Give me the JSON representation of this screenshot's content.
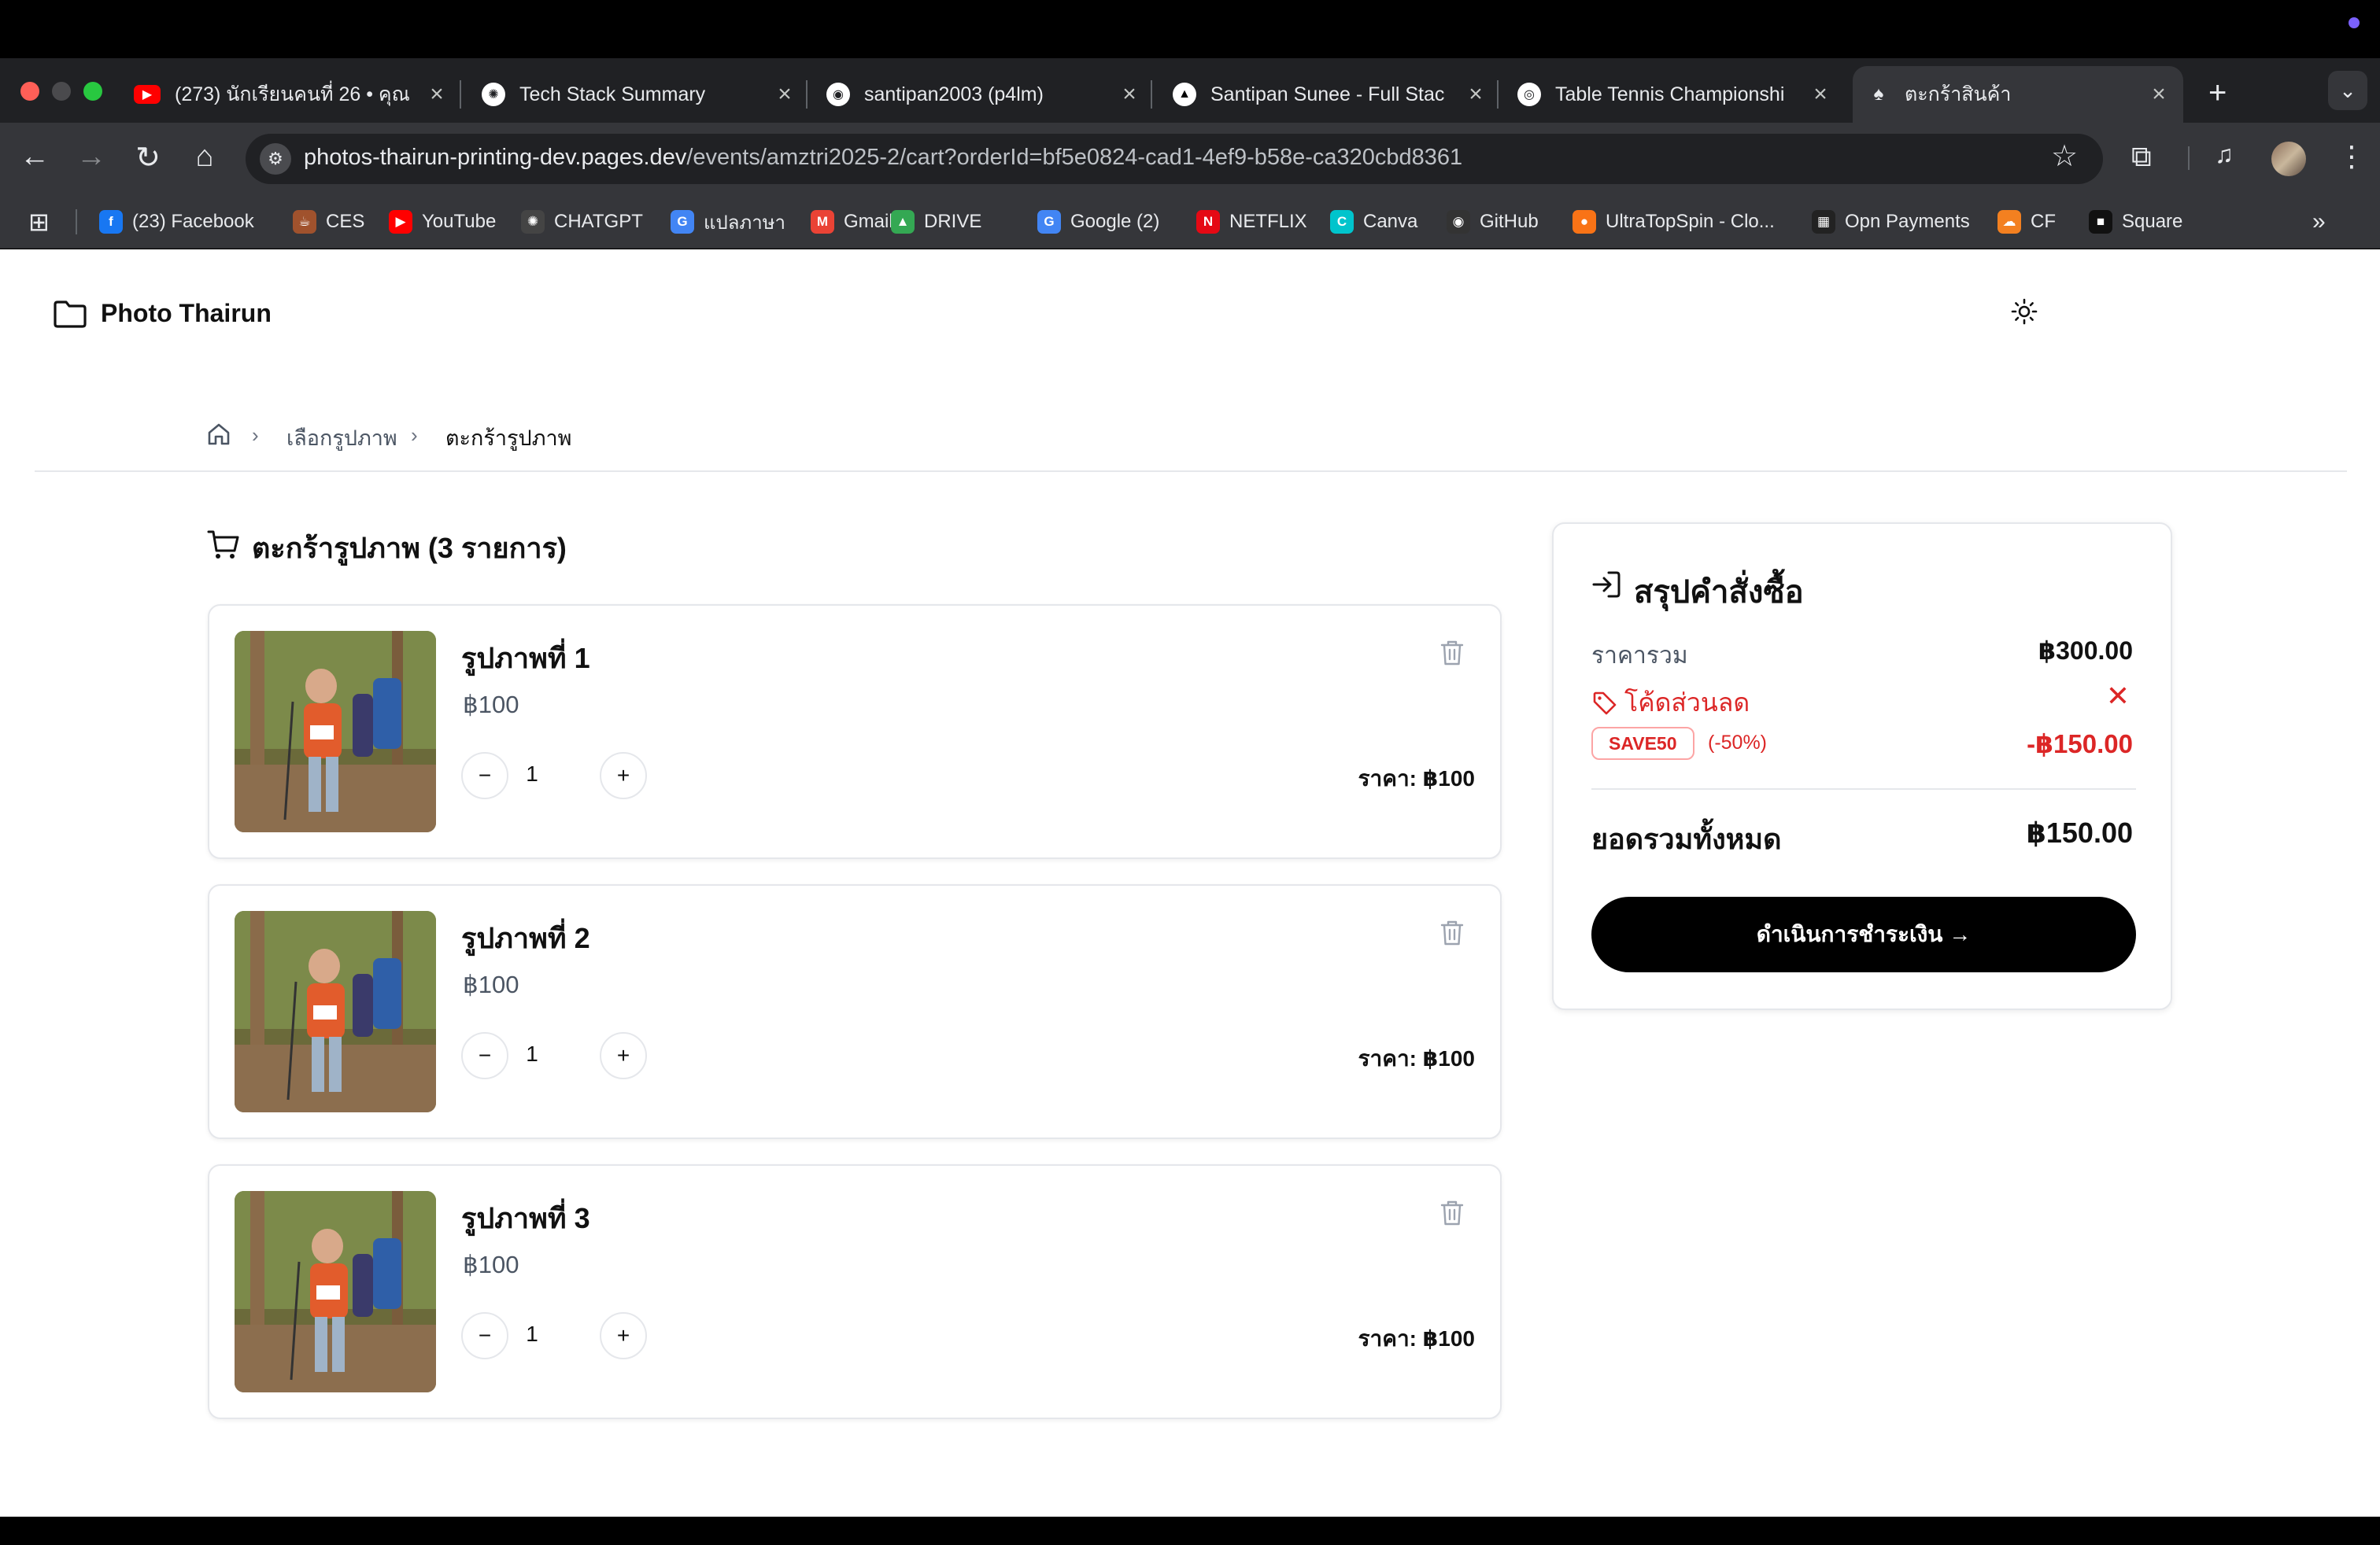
{
  "browser": {
    "tabs": [
      {
        "title": "(273) นักเรียนคนที่ 26 • คุณ",
        "icon": "youtube-icon",
        "color": "#ff0000"
      },
      {
        "title": "Tech Stack Summary",
        "icon": "openai-icon",
        "color": "#ffffff"
      },
      {
        "title": "santipan2003 (p4lm)",
        "icon": "github-icon",
        "color": "#ffffff"
      },
      {
        "title": "Santipan Sunee - Full Stac",
        "icon": "triangle-icon",
        "color": "#000000"
      },
      {
        "title": "Table Tennis Championshi",
        "icon": "ping-icon",
        "color": "#ffffff"
      },
      {
        "title": "ตะกร้าสินค้า",
        "icon": "astro-icon",
        "color": "#35363a"
      }
    ],
    "new_tab": "+",
    "url_host": "photos-thairun-printing-dev.pages.dev",
    "url_path": "/events/amztri2025-2/cart?orderId=bf5e0824-cad1-4ef9-b58e-ca320cbd8361",
    "bookmarks": [
      {
        "label": "(23) Facebook",
        "color": "#1877f2",
        "glyph": "f"
      },
      {
        "label": "CES",
        "color": "#a0522d",
        "glyph": "☕"
      },
      {
        "label": "YouTube",
        "color": "#ff0000",
        "glyph": "▶"
      },
      {
        "label": "CHATGPT",
        "color": "#444",
        "glyph": "✺"
      },
      {
        "label": "แปลภาษา",
        "color": "#4285f4",
        "glyph": "G"
      },
      {
        "label": "Gmail",
        "color": "#ea4335",
        "glyph": "M"
      },
      {
        "label": "DRIVE",
        "color": "#34a853",
        "glyph": "▲"
      },
      {
        "label": "Google (2)",
        "color": "#4285f4",
        "glyph": "G"
      },
      {
        "label": "NETFLIX",
        "color": "#e50914",
        "glyph": "N"
      },
      {
        "label": "Canva",
        "color": "#00c4cc",
        "glyph": "C"
      },
      {
        "label": "GitHub",
        "color": "#333",
        "glyph": "◉"
      },
      {
        "label": "UltraTopSpin - Clo...",
        "color": "#f97316",
        "glyph": "●"
      },
      {
        "label": "Opn Payments",
        "color": "#222",
        "glyph": "▦"
      },
      {
        "label": "CF",
        "color": "#f38020",
        "glyph": "☁"
      },
      {
        "label": "Square",
        "color": "#111",
        "glyph": "■"
      }
    ],
    "more_bookmarks": "»"
  },
  "site": {
    "brand": "Photo Thairun"
  },
  "breadcrumb": {
    "separator": "›",
    "link": "เลือกรูปภาพ",
    "current": "ตะกร้ารูปภาพ"
  },
  "cart": {
    "title": "ตะกร้ารูปภาพ (3 รายการ)",
    "items": [
      {
        "name": "รูปภาพที่ 1",
        "price": "฿100",
        "qty": "1",
        "line_total": "ราคา: ฿100"
      },
      {
        "name": "รูปภาพที่ 2",
        "price": "฿100",
        "qty": "1",
        "line_total": "ราคา: ฿100"
      },
      {
        "name": "รูปภาพที่ 3",
        "price": "฿100",
        "qty": "1",
        "line_total": "ราคา: ฿100"
      }
    ],
    "minus": "−",
    "plus": "+"
  },
  "summary": {
    "title": "สรุปคำสั่งซื้อ",
    "subtotal_label": "ราคารวม",
    "subtotal_value": "฿300.00",
    "discount_label": "โค้ดส่วนลด",
    "discount_remove": "✕",
    "code": "SAVE50",
    "code_pct": "(-50%)",
    "discount_value": "-฿150.00",
    "grand_label": "ยอดรวมทั้งหมด",
    "grand_value": "฿150.00",
    "checkout_label": "ดำเนินการชำระเงิน →"
  }
}
